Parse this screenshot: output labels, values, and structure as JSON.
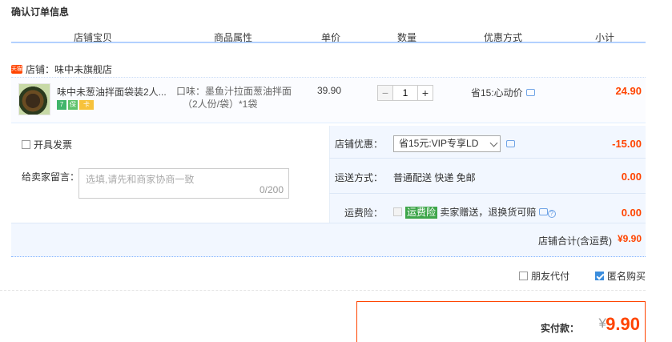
{
  "title": "确认订单信息",
  "columns": [
    "店铺宝贝",
    "商品属性",
    "单价",
    "数量",
    "优惠方式",
    "小计"
  ],
  "store": {
    "icon_text": "天猫",
    "label": "店铺：味中未旗舰店"
  },
  "item": {
    "name": "味中未葱油拌面袋装2人...",
    "badges": [
      "7",
      "保",
      "卡"
    ],
    "spec_line1": "口味：墨鱼汁拉面葱油拌面",
    "spec_line2": "（2人份/袋）*1袋",
    "price": "39.90",
    "quantity": "1",
    "minus": "−",
    "plus": "+",
    "promo": "省15:心动价",
    "subtotal": "24.90"
  },
  "invoice_label": "开具发票",
  "message": {
    "label": "给卖家留言：",
    "placeholder": "选填,请先和商家协商一致",
    "count": "0/200"
  },
  "store_discount": {
    "label": "店铺优惠：",
    "selected": "省15元:VIP专享LD",
    "amount": "-15.00"
  },
  "shipping": {
    "label": "运送方式：",
    "value": "普通配送 快递 免邮",
    "amount": "0.00"
  },
  "insurance": {
    "label": "运费险：",
    "tag": "运费险",
    "text": "卖家赠送，退换货可赔",
    "amount": "0.00"
  },
  "store_total": {
    "label": "店铺合计(含运费)",
    "value": "¥9.90"
  },
  "friend_pay": "朋友代付",
  "anonymous": "匿名购买",
  "real_pay": {
    "label": "实付款：",
    "symbol": "¥",
    "value": "9.90"
  },
  "colors": {
    "accent": "#ff4400",
    "border_blue": "#b2d1ff",
    "tag_green": "#3ea64a"
  }
}
